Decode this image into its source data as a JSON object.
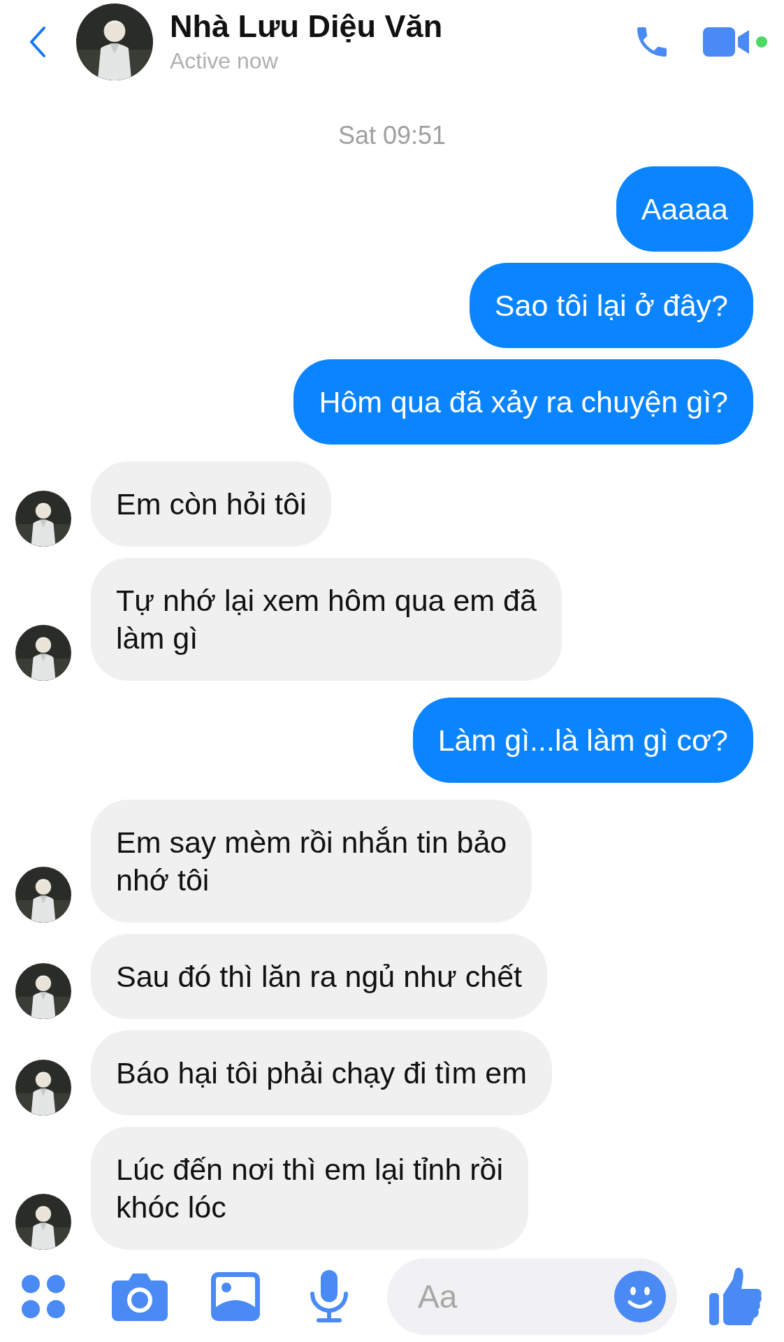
{
  "header": {
    "name": "Nhà Lưu Diệu Văn",
    "status": "Active now",
    "online": true
  },
  "timestamp": "Sat 09:51",
  "messages": [
    {
      "kind": "sent",
      "text": "Aaaaa"
    },
    {
      "kind": "sent",
      "text": "Sao tôi lại ở đây?"
    },
    {
      "kind": "sent",
      "text": "Hôm qua đã xảy ra chuyện gì?"
    },
    {
      "kind": "received",
      "text": "Em còn hỏi tôi"
    },
    {
      "kind": "received",
      "text": "Tự nhớ lại xem hôm qua em đã\nlàm gì"
    },
    {
      "kind": "sent",
      "text": "Làm gì...là làm gì cơ?"
    },
    {
      "kind": "received",
      "text": "Em say mèm rồi nhắn tin bảo\nnhớ tôi"
    },
    {
      "kind": "received",
      "text": "Sau đó thì lăn ra ngủ như chết"
    },
    {
      "kind": "received",
      "text": "Báo hại tôi phải chạy đi tìm em"
    },
    {
      "kind": "received",
      "text": "Lúc đến nơi thì em lại tỉnh rồi\nkhóc lóc"
    }
  ],
  "composer": {
    "placeholder": "Aa"
  }
}
